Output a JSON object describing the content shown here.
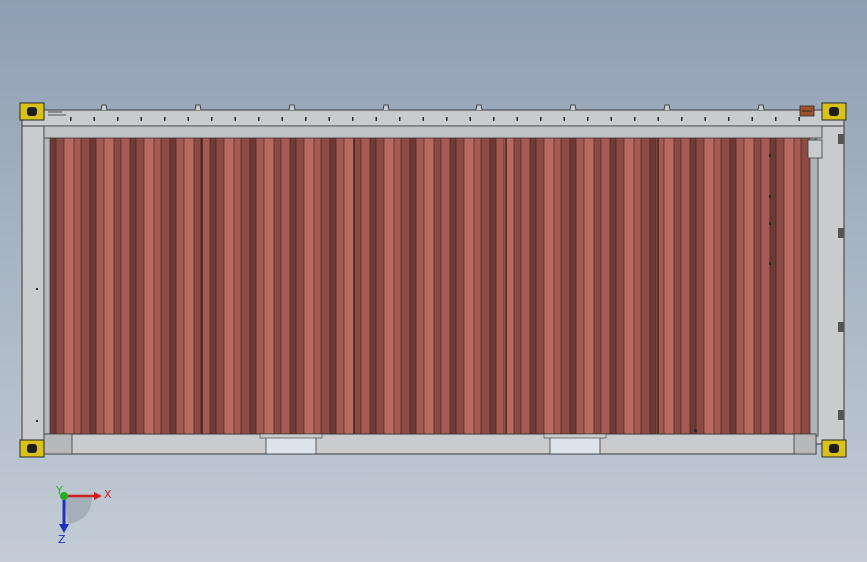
{
  "viewport": {
    "background_top": "#8f9fb3",
    "background_bottom": "#c3ccd6"
  },
  "model": {
    "part": "shipping-container-side-view",
    "corrugated_panel_colors": [
      "#6e3a36",
      "#8c4a44",
      "#a55a52",
      "#b86a60"
    ],
    "frame_color": "#c9cbcd",
    "frame_stroke": "#3a3a3a",
    "corner_casting_color": "#d8c21a"
  },
  "triad": {
    "x_label": "X",
    "y_label": "Y",
    "z_label": "Z",
    "x_color": "#d02020",
    "y_color": "#22b022",
    "z_color": "#2030c0"
  }
}
